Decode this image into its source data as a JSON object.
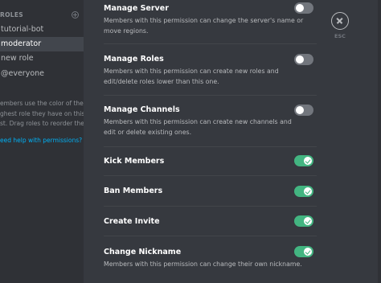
{
  "sidebar": {
    "header": "ROLES",
    "roles": [
      {
        "label": "tutorial-bot"
      },
      {
        "label": "moderator"
      },
      {
        "label": "new role"
      },
      {
        "label": "@everyone"
      }
    ],
    "help_lines": [
      "embers use the color of the",
      "ghest role they have on this",
      "st. Drag roles to reorder them!"
    ],
    "help_link": "eed help with permissions?"
  },
  "permissions": [
    {
      "title": "Manage Server",
      "desc": "Members with this permission can change the server's name or move regions.",
      "enabled": false
    },
    {
      "title": "Manage Roles",
      "desc": "Members with this permission can create new roles and edit/delete roles lower than this one.",
      "enabled": false
    },
    {
      "title": "Manage Channels",
      "desc": "Members with this permission can create new channels and edit or delete existing ones.",
      "enabled": false
    },
    {
      "title": "Kick Members",
      "desc": "",
      "enabled": true
    },
    {
      "title": "Ban Members",
      "desc": "",
      "enabled": true
    },
    {
      "title": "Create Invite",
      "desc": "",
      "enabled": true
    },
    {
      "title": "Change Nickname",
      "desc": "Members with this permission can change their own nickname.",
      "enabled": true
    }
  ],
  "close": {
    "esc_label": "ESC"
  },
  "colors": {
    "toggle_on": "#43b581",
    "toggle_off": "#72767d",
    "link": "#00b0f4",
    "background": "#36393f",
    "sidebar": "#2f3136"
  }
}
